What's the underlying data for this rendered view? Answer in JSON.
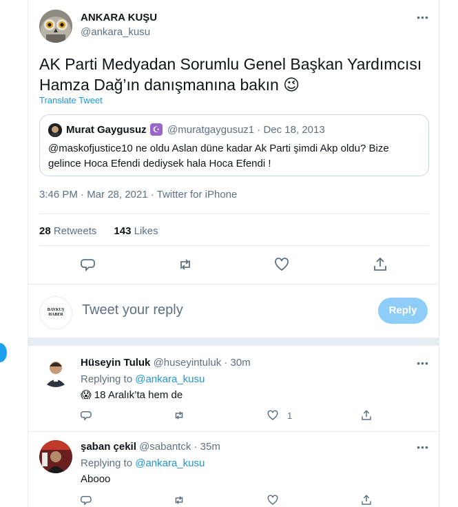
{
  "main_tweet": {
    "author_name": "ANKARA KUŞU",
    "author_handle": "@ankara_kusu",
    "text": "AK Parti Medyadan Sorumlu Genel Başkan Yardımcısı Hamza Dağ’ın danışmanına bakın 😉",
    "translate_label": "Translate Tweet",
    "quoted": {
      "author_name": "Murat Gaygusuz",
      "badge_icon": "crescent-star-icon",
      "meta": "@muratgaygusuz1 · Dec 18, 2013",
      "text": "@maskofjustice10 ne oldu Aslan düne kadar Ak Parti şimdi Akp oldu?  Bize gelince Hoca Efendi dediysek hala Hoca Efendi !"
    },
    "timestamp": "3:46 PM · Mar 28, 2021 · Twitter for iPhone",
    "retweets_count": "28",
    "retweets_label": "Retweets",
    "likes_count": "143",
    "likes_label": "Likes"
  },
  "compose": {
    "avatar_text": "BAYKUŞ HABER",
    "placeholder": "Tweet your reply",
    "button_label": "Reply"
  },
  "replies": [
    {
      "name": "Hüseyin Tuluk",
      "handle_time": "@huseyintuluk · 30m",
      "replying_prefix": "Replying to",
      "replying_to": "@ankara_kusu",
      "text": "😱 18 Aralık’ta hem de",
      "like_count": "1"
    },
    {
      "name": "şaban çekil",
      "handle_time": "@sabantck · 35m",
      "replying_prefix": "Replying to",
      "replying_to": "@ankara_kusu",
      "text": "Abooo",
      "like_count": ""
    }
  ],
  "colors": {
    "accent": "#1b95e0",
    "muted": "#5b7083",
    "reply_button": "#8ecdf8",
    "border": "#e6ecf0"
  }
}
